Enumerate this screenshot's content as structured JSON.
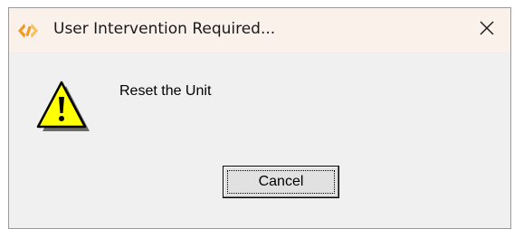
{
  "window": {
    "title": "User Intervention Required...",
    "app_icon": "app-logo-icon",
    "close_icon": "close-icon"
  },
  "content": {
    "icon": "warning-icon",
    "message": "Reset the Unit"
  },
  "buttons": {
    "cancel_label": "Cancel"
  },
  "colors": {
    "titlebar_bg": "#f9f1ea",
    "dialog_bg": "#f0f0f0",
    "warning_yellow": "#ffff00",
    "logo_orange": "#f39a1e"
  }
}
